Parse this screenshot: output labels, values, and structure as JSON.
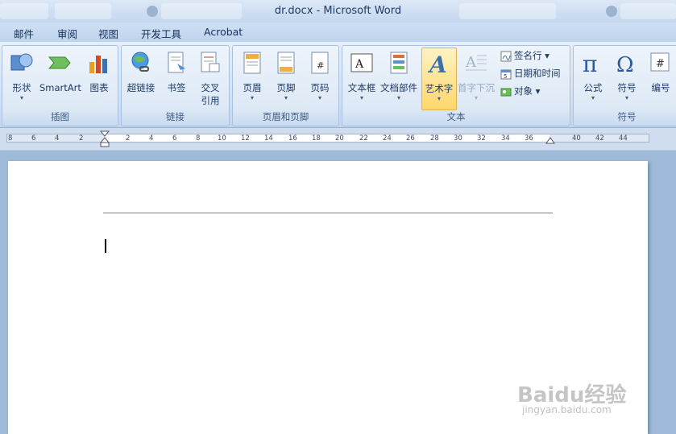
{
  "window": {
    "title": "dr.docx - Microsoft Word"
  },
  "menu": [
    "邮件",
    "审阅",
    "视图",
    "开发工具",
    "Acrobat"
  ],
  "groups": {
    "illustrations": {
      "label": "插图",
      "items": [
        "形状",
        "SmartArt",
        "图表"
      ]
    },
    "links": {
      "label": "链接",
      "items": [
        "超链接",
        "书签",
        "交叉",
        "引用"
      ]
    },
    "header_footer": {
      "label": "页眉和页脚",
      "items": [
        "页眉",
        "页脚",
        "页码"
      ]
    },
    "text": {
      "label": "文本",
      "items": [
        "文本框",
        "文档部件",
        "艺术字",
        "首字下沉"
      ],
      "small": [
        "签名行",
        "日期和时间",
        "对象"
      ]
    },
    "symbols": {
      "label": "符号",
      "items": [
        "公式",
        "符号",
        "编号"
      ]
    }
  },
  "ruler": {
    "ticks": [
      "8",
      "6",
      "4",
      "2",
      "2",
      "4",
      "6",
      "8",
      "10",
      "12",
      "14",
      "16",
      "18",
      "20",
      "22",
      "24",
      "26",
      "28",
      "30",
      "32",
      "34",
      "36",
      "40",
      "42",
      "44"
    ]
  },
  "watermark": {
    "main": "Baidu经验",
    "sub": "jingyan.baidu.com"
  },
  "colors": {
    "accent": "#ffd66b",
    "ribbon": "#dde9f6",
    "canvas": "#9fb9d9"
  }
}
